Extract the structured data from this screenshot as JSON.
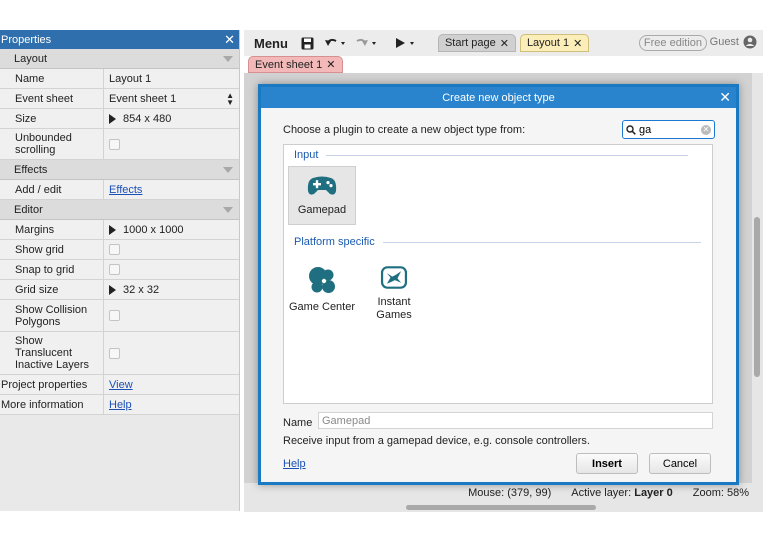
{
  "properties": {
    "title": "Properties",
    "sections": {
      "layout": "Layout",
      "effects": "Effects",
      "editor": "Editor"
    },
    "rows": {
      "name": {
        "label": "Name",
        "value": "Layout 1"
      },
      "event_sheet": {
        "label": "Event sheet",
        "value": "Event sheet 1"
      },
      "size": {
        "label": "Size",
        "value": "854 x 480"
      },
      "unbounded": {
        "label": "Unbounded scrolling"
      },
      "add_edit": {
        "label": "Add / edit",
        "value": "Effects"
      },
      "margins": {
        "label": "Margins",
        "value": "1000 x 1000"
      },
      "show_grid": {
        "label": "Show grid"
      },
      "snap_grid": {
        "label": "Snap to grid"
      },
      "grid_size": {
        "label": "Grid size",
        "value": "32 x 32"
      },
      "show_collision": {
        "label": "Show Collision Polygons"
      },
      "show_translucent": {
        "label": "Show Translucent Inactive Layers"
      },
      "project_props": {
        "label": "Project properties",
        "value": "View"
      },
      "more_info": {
        "label": "More information",
        "value": "Help"
      }
    }
  },
  "toolbar": {
    "menu_label": "Menu",
    "tabs": [
      {
        "label": "Start page"
      },
      {
        "label": "Layout 1"
      }
    ],
    "edition": "Free edition",
    "user": "Guest"
  },
  "event_tab": {
    "label": "Event sheet 1"
  },
  "status": {
    "mouse": "Mouse: (379, 99)",
    "active_layer_label": "Active layer:",
    "active_layer_value": "Layer 0",
    "zoom": "Zoom: 58%"
  },
  "dialog": {
    "title": "Create new object type",
    "prompt": "Choose a plugin to create a new object type from:",
    "search_value": "ga",
    "categories": [
      {
        "name": "Input",
        "plugins": [
          {
            "name": "Gamepad",
            "icon": "gamepad-icon"
          }
        ]
      },
      {
        "name": "Platform specific",
        "plugins": [
          {
            "name": "Game Center",
            "icon": "game-center-icon"
          },
          {
            "name": "Instant Games",
            "icon": "instant-games-icon"
          }
        ]
      }
    ],
    "name_label": "Name",
    "name_value": "Gamepad",
    "description": "Receive input from a gamepad device, e.g. console controllers.",
    "help_label": "Help",
    "insert_label": "Insert",
    "cancel_label": "Cancel"
  },
  "colors": {
    "accent": "#2a83cd",
    "panel_header": "#2f6fad",
    "icon_teal": "#1f6f80",
    "layout_tab": "#fbeeb8",
    "event_tab": "#f3b9b9"
  }
}
